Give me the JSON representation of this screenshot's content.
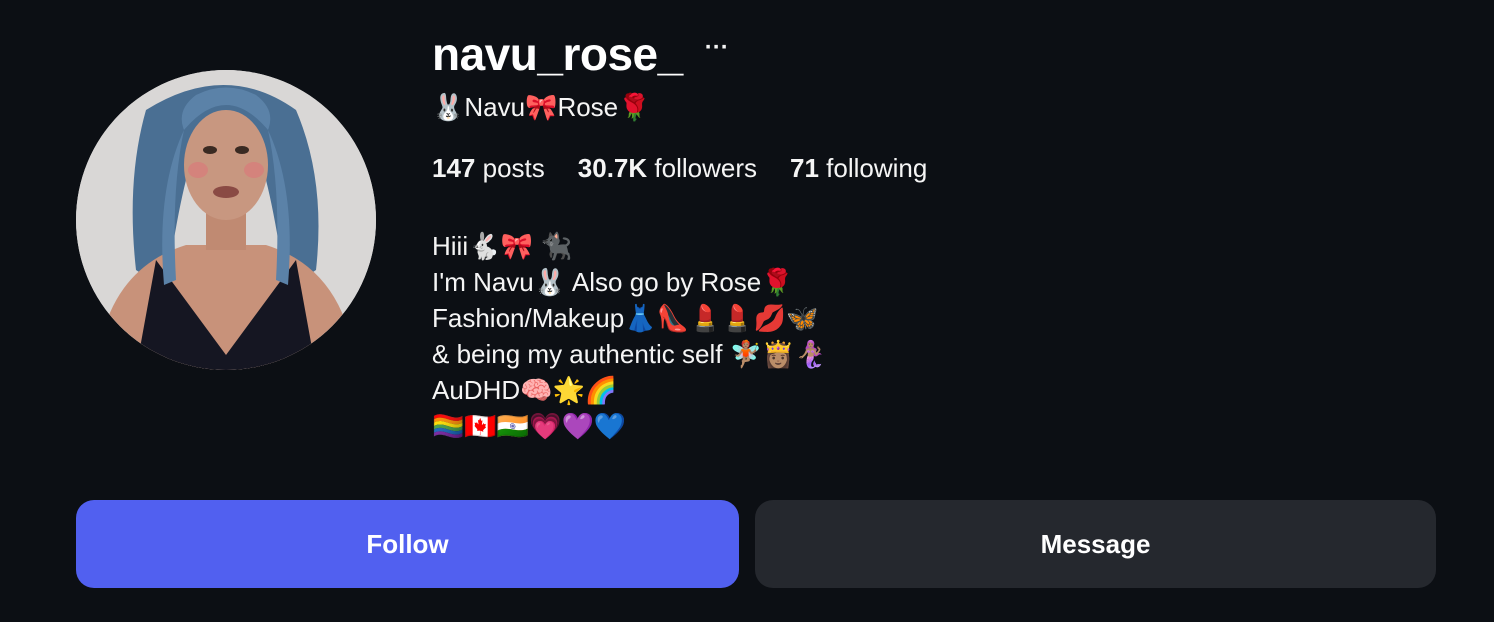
{
  "profile": {
    "username": "navu_rose_",
    "more_label": "···",
    "display_name": "🐰Navu🎀Rose🌹",
    "stats": {
      "posts_count": "147",
      "posts_label": "posts",
      "followers_count": "30.7K",
      "followers_label": "followers",
      "following_count": "71",
      "following_label": "following"
    },
    "bio": [
      "Hiii🐇🎀 🐈‍⬛",
      "I'm Navu🐰 Also go by Rose🌹",
      "Fashion/Makeup👗👠💄💄💋🦋",
      "& being my authentic self 🧚🏽👸🏽🧜🏽‍♀️",
      "AuDHD🧠🌟🌈",
      "🏳️‍🌈🇨🇦🇮🇳💗💜💙"
    ]
  },
  "actions": {
    "follow_label": "Follow",
    "message_label": "Message"
  },
  "colors": {
    "background": "#0c0f14",
    "follow_button": "#5160f0",
    "message_button": "#25282e",
    "text": "#f5f5f5"
  }
}
